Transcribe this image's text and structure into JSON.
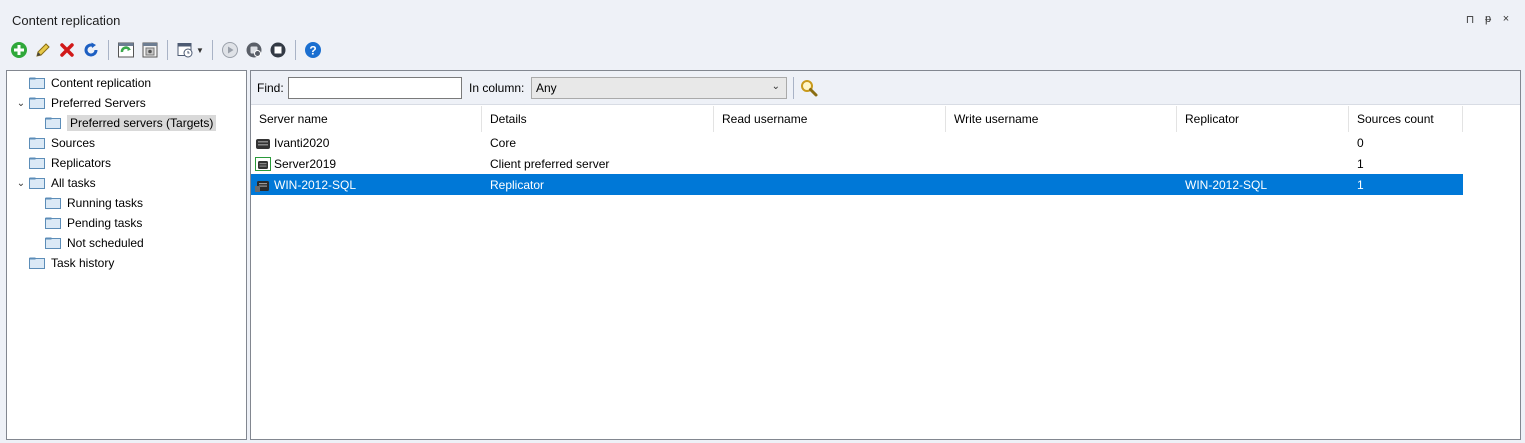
{
  "window": {
    "title": "Content replication",
    "controls": {
      "pin": "⊓",
      "dock": "ᵽ",
      "close": "×"
    }
  },
  "toolbar": {
    "buttons": [
      {
        "name": "add-icon",
        "color": "#2fa83a"
      },
      {
        "name": "edit-pencil-icon",
        "color": "#d6b32a"
      },
      {
        "name": "delete-icon",
        "color": "#d11919"
      },
      {
        "name": "refresh-icon",
        "color": "#1d5fc2"
      },
      {
        "name": "replicate-icon",
        "color": "#3aa84b"
      },
      {
        "name": "properties-icon",
        "color": "#6a6a6a"
      },
      {
        "name": "schedule-icon",
        "color": "#4d5b73"
      },
      {
        "name": "start-icon",
        "color": "#9aa0aa"
      },
      {
        "name": "pause-icon",
        "color": "#5a5f68"
      },
      {
        "name": "stop-icon",
        "color": "#333a45"
      },
      {
        "name": "help-icon",
        "color": "#1b6fd0"
      }
    ]
  },
  "tree": {
    "items": [
      {
        "label": "Content replication",
        "expanded": null
      },
      {
        "label": "Preferred Servers",
        "expanded": true
      },
      {
        "label": "Preferred servers (Targets)",
        "selected": true
      },
      {
        "label": "Sources"
      },
      {
        "label": "Replicators"
      },
      {
        "label": "All tasks",
        "expanded": true
      },
      {
        "label": "Running tasks"
      },
      {
        "label": "Pending tasks"
      },
      {
        "label": "Not scheduled"
      },
      {
        "label": "Task history"
      }
    ]
  },
  "find": {
    "label": "Find:",
    "value": "",
    "column_label": "In column:",
    "column_value": "Any"
  },
  "grid": {
    "columns": [
      "Server name",
      "Details",
      "Read username",
      "Write username",
      "Replicator",
      "Sources count"
    ],
    "rows": [
      {
        "server": "Ivanti2020",
        "details": "Core",
        "read": "",
        "write": "",
        "replicator": "",
        "count": "0"
      },
      {
        "server": "Server2019",
        "details": "Client preferred server",
        "read": "",
        "write": "",
        "replicator": "",
        "count": "1"
      },
      {
        "server": "WIN-2012-SQL",
        "details": "Replicator",
        "read": "",
        "write": "",
        "replicator": "WIN-2012-SQL",
        "count": "1",
        "selected": true
      }
    ]
  },
  "colors": {
    "selection": "#0078d7",
    "tree_selection": "#d9d9d9",
    "background": "#eef1f7"
  }
}
